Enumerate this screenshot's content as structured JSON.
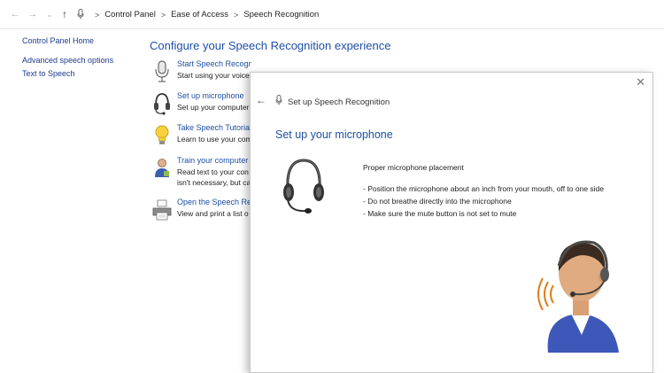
{
  "breadcrumb": {
    "items": [
      "Control Panel",
      "Ease of Access",
      "Speech Recognition"
    ],
    "separator": ">"
  },
  "nav_icons": {
    "back": "arrow-left-icon",
    "forward": "arrow-right-icon",
    "recent": "chevron-down-icon",
    "up": "arrow-up-icon",
    "location": "microphone-icon"
  },
  "left_nav": {
    "home": "Control Panel Home",
    "advanced": "Advanced speech options",
    "tts": "Text to Speech"
  },
  "main": {
    "title": "Configure your Speech Recognition experience",
    "items": [
      {
        "link": "Start Speech Recognition",
        "desc": [
          "Start using your voice"
        ],
        "icon": "microphone-icon"
      },
      {
        "link": "Set up microphone",
        "desc": [
          "Set up your computer"
        ],
        "icon": "headset-icon"
      },
      {
        "link": "Take Speech Tutorial",
        "desc": [
          "Learn to use your com"
        ],
        "icon": "lightbulb-icon"
      },
      {
        "link": "Train your computer",
        "desc": [
          "Read text to your con",
          "isn't necessary, but ca"
        ],
        "icon": "person-icon"
      },
      {
        "link": "Open the Speech Ref",
        "desc": [
          "View and print a list o"
        ],
        "icon": "printer-icon"
      }
    ]
  },
  "dialog": {
    "header": "Set up Speech Recognition",
    "title": "Set up your microphone",
    "subtitle": "Proper microphone placement",
    "bullets": [
      "- Position the microphone about an inch from your mouth, off to one side",
      "- Do not breathe directly into the microphone",
      "- Make sure the mute button is not set to mute"
    ],
    "close_glyph": "✕",
    "back_glyph": "←"
  },
  "colors": {
    "link": "#1e4fa6",
    "left_link": "#1f3b8c",
    "text": "#222222"
  }
}
